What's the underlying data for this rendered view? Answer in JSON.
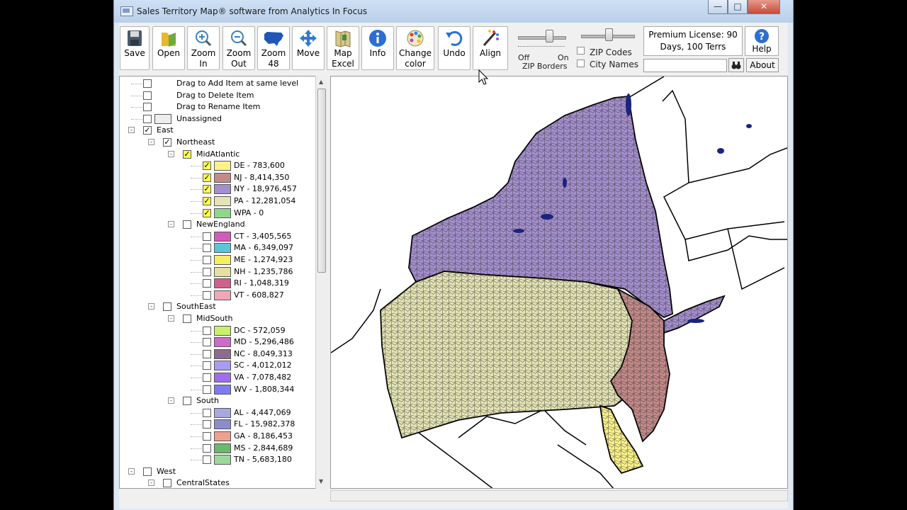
{
  "window": {
    "title": "Sales Territory Map® software from Analytics In Focus"
  },
  "toolbar": {
    "buttons": [
      {
        "label": "Save",
        "icon": "floppy-disk-icon"
      },
      {
        "label": "Open",
        "icon": "folder-open-icon"
      },
      {
        "label": "Zoom In",
        "icon": "zoom-in-icon"
      },
      {
        "label": "Zoom Out",
        "icon": "zoom-out-icon"
      },
      {
        "label": "Zoom 48",
        "icon": "us-map-icon"
      },
      {
        "label": "Move",
        "icon": "move-arrows-icon"
      },
      {
        "label": "Map Excel",
        "icon": "map-excel-icon"
      },
      {
        "label": "Info",
        "icon": "info-icon"
      },
      {
        "label": "Change color",
        "icon": "color-palette-icon"
      },
      {
        "label": "Undo",
        "icon": "undo-icon"
      },
      {
        "label": "Align",
        "icon": "align-brush-icon"
      }
    ],
    "zip_borders": {
      "off_label": "Off",
      "on_label": "On",
      "caption": "ZIP Borders"
    },
    "zip_codes_label": "ZIP Codes",
    "city_names_label": "City Names",
    "license_text_1": "Premium License: 90",
    "license_text_2": "Days, 100 Terrs",
    "help_label": "Help",
    "about_label": "About",
    "search_value": ""
  },
  "tree": {
    "nodes": [
      {
        "label": "Drag to Add Item at same level",
        "level": 0,
        "checked": false,
        "swatch": null,
        "expander": null
      },
      {
        "label": "Drag to Delete Item",
        "level": 0,
        "checked": false,
        "swatch": null,
        "expander": null
      },
      {
        "label": "Drag to Rename Item",
        "level": 0,
        "checked": false,
        "swatch": null,
        "expander": null
      },
      {
        "label": "Unassigned",
        "level": 0,
        "checked": false,
        "swatch": "#eeeeee",
        "expander": null
      },
      {
        "label": "East",
        "level": 0,
        "checked": true,
        "swatch": null,
        "expander": "-"
      },
      {
        "label": "Northeast",
        "level": 1,
        "checked": true,
        "swatch": null,
        "expander": "-"
      },
      {
        "label": "MidAtlantic",
        "level": 2,
        "checked": true,
        "swatch": null,
        "expander": "-",
        "yellow": true
      },
      {
        "label": "DE - 783,600",
        "level": 3,
        "checked": true,
        "swatch": "#fbf28a",
        "yellow": true
      },
      {
        "label": "NJ - 8,414,350",
        "level": 3,
        "checked": true,
        "swatch": "#c48a8a",
        "yellow": true
      },
      {
        "label": "NY - 18,976,457",
        "level": 3,
        "checked": true,
        "swatch": "#a48fce",
        "yellow": true
      },
      {
        "label": "PA - 12,281,054",
        "level": 3,
        "checked": true,
        "swatch": "#e4e4b4",
        "yellow": true
      },
      {
        "label": "WPA - 0",
        "level": 3,
        "checked": true,
        "swatch": "#8ed88e",
        "yellow": true
      },
      {
        "label": "NewEngland",
        "level": 2,
        "checked": false,
        "swatch": null,
        "expander": "-"
      },
      {
        "label": "CT - 3,405,565",
        "level": 3,
        "checked": false,
        "swatch": "#d25cbc"
      },
      {
        "label": "MA - 6,349,097",
        "level": 3,
        "checked": false,
        "swatch": "#58c8d8"
      },
      {
        "label": "ME - 1,274,923",
        "level": 3,
        "checked": false,
        "swatch": "#f4ee62"
      },
      {
        "label": "NH - 1,235,786",
        "level": 3,
        "checked": false,
        "swatch": "#e6e0a0"
      },
      {
        "label": "RI - 1,048,319",
        "level": 3,
        "checked": false,
        "swatch": "#d0608a"
      },
      {
        "label": "VT - 608,827",
        "level": 3,
        "checked": false,
        "swatch": "#f0a8b8"
      },
      {
        "label": "SouthEast",
        "level": 1,
        "checked": false,
        "swatch": null,
        "expander": "-"
      },
      {
        "label": "MidSouth",
        "level": 2,
        "checked": false,
        "swatch": null,
        "expander": "-"
      },
      {
        "label": "DC - 572,059",
        "level": 3,
        "checked": false,
        "swatch": "#c8f06c"
      },
      {
        "label": "MD - 5,296,486",
        "level": 3,
        "checked": false,
        "swatch": "#cc6cc8"
      },
      {
        "label": "NC - 8,049,313",
        "level": 3,
        "checked": false,
        "swatch": "#8c6c8c"
      },
      {
        "label": "SC - 4,012,012",
        "level": 3,
        "checked": false,
        "swatch": "#a89cf0"
      },
      {
        "label": "VA - 7,078,482",
        "level": 3,
        "checked": false,
        "swatch": "#a06cf0"
      },
      {
        "label": "WV - 1,808,344",
        "level": 3,
        "checked": false,
        "swatch": "#7c7cf0"
      },
      {
        "label": "South",
        "level": 2,
        "checked": false,
        "swatch": null,
        "expander": "-"
      },
      {
        "label": "AL - 4,447,069",
        "level": 3,
        "checked": false,
        "swatch": "#a8a8e0"
      },
      {
        "label": "FL - 15,982,378",
        "level": 3,
        "checked": false,
        "swatch": "#8c8ccc"
      },
      {
        "label": "GA - 8,186,453",
        "level": 3,
        "checked": false,
        "swatch": "#f0a090"
      },
      {
        "label": "MS - 2,844,689",
        "level": 3,
        "checked": false,
        "swatch": "#6cb86c"
      },
      {
        "label": "TN - 5,683,180",
        "level": 3,
        "checked": false,
        "swatch": "#9cd89c"
      },
      {
        "label": "West",
        "level": 0,
        "checked": false,
        "swatch": null,
        "expander": "-"
      },
      {
        "label": "CentralStates",
        "level": 1,
        "checked": false,
        "swatch": null,
        "expander": "-"
      }
    ]
  },
  "map": {
    "colors": {
      "NY": "#a48fce",
      "PA": "#e4e4b4",
      "NJ": "#c48a8a",
      "DE": "#fbf28a",
      "water": "#1a237e"
    }
  }
}
